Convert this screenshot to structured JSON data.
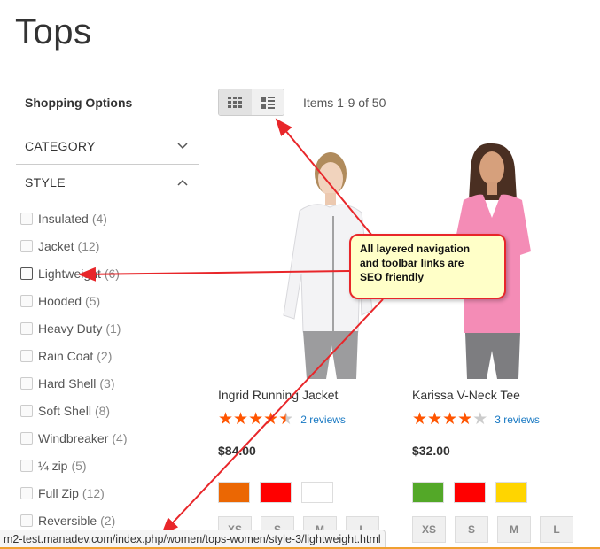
{
  "page": {
    "title": "Tops"
  },
  "sidebar": {
    "heading": "Shopping Options",
    "filters": [
      {
        "label": "CATEGORY",
        "expanded": false,
        "icon": "chevron-down-icon"
      },
      {
        "label": "STYLE",
        "expanded": true,
        "icon": "chevron-up-icon"
      }
    ],
    "style_options": [
      {
        "label": "Insulated",
        "count": "(4)"
      },
      {
        "label": "Jacket",
        "count": "(12)"
      },
      {
        "label": "Lightweight",
        "count": "(6)",
        "hovered": true
      },
      {
        "label": "Hooded",
        "count": "(5)"
      },
      {
        "label": "Heavy Duty",
        "count": "(1)"
      },
      {
        "label": "Rain Coat",
        "count": "(2)"
      },
      {
        "label": "Hard Shell",
        "count": "(3)"
      },
      {
        "label": "Soft Shell",
        "count": "(8)"
      },
      {
        "label": "Windbreaker",
        "count": "(4)"
      },
      {
        "label": "¼ zip",
        "count": "(5)"
      },
      {
        "label": "Full Zip",
        "count": "(12)"
      },
      {
        "label": "Reversible",
        "count": "(2)"
      }
    ]
  },
  "toolbar": {
    "modes": [
      {
        "name": "grid",
        "icon": "grid-icon",
        "active": true
      },
      {
        "name": "list",
        "icon": "list-icon",
        "active": false
      }
    ],
    "items_count": "Items 1-9 of 50"
  },
  "products": [
    {
      "name": "Ingrid Running Jacket",
      "rating": 4.5,
      "reviews": "2 reviews",
      "price": "$84.00",
      "colors": [
        "#eb6703",
        "#ff0000",
        "#ffffff"
      ],
      "sizes": [
        "XS",
        "S",
        "M",
        "L"
      ],
      "image": "woman-white-jacket"
    },
    {
      "name": "Karissa V-Neck Tee",
      "rating": 4,
      "reviews": "3 reviews",
      "price": "$32.00",
      "colors": [
        "#53a828",
        "#ff0000",
        "#ffd500"
      ],
      "sizes": [
        "XS",
        "S",
        "M",
        "L"
      ],
      "image": "woman-pink-tee"
    }
  ],
  "callout": {
    "line1": "All layered navigation",
    "line2": "and toolbar links are",
    "line3": "SEO friendly"
  },
  "statusbar": {
    "url": "m2-test.manadev.com/index.php/women/tops-women/style-3/lightweight.html"
  },
  "colors": {
    "star": "#ff5501",
    "link": "#1979c3",
    "annotation": "#e8262a"
  }
}
